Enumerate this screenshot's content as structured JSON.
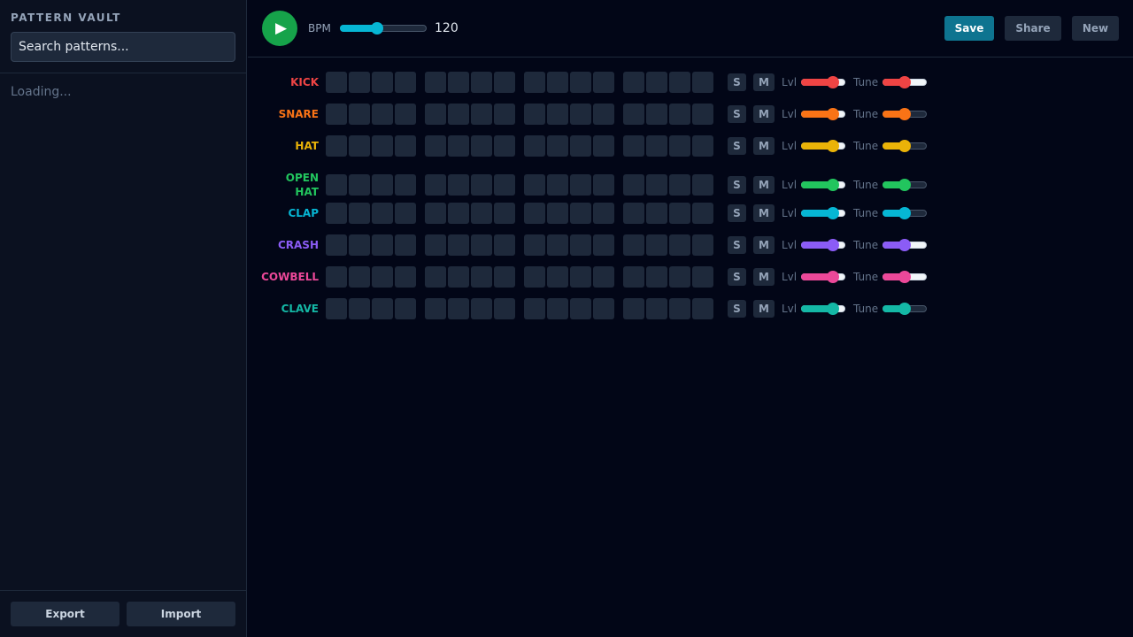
{
  "sidebar": {
    "title": "PATTERN VAULT",
    "search_placeholder": "Search patterns...",
    "status": "Loading...",
    "export_label": "Export",
    "import_label": "Import"
  },
  "transport": {
    "play_glyph": "▶",
    "bpm_label": "BPM",
    "bpm_value": "120",
    "bpm_fraction": 0.43,
    "save_label": "Save",
    "share_label": "Share",
    "new_label": "New"
  },
  "controls": {
    "solo_label": "S",
    "mute_label": "M",
    "level_label": "Lvl",
    "tune_label": "Tune"
  },
  "colors": {
    "play": "#16a34a",
    "accent": "#0e7490",
    "bpm": "#06b6d4"
  },
  "tracks": [
    {
      "name": "KICK",
      "lines": [
        "KICK"
      ],
      "color": "#ef4444",
      "level": 0.72,
      "tune": 0.5,
      "tune_light": true
    },
    {
      "name": "SNARE",
      "lines": [
        "SNARE"
      ],
      "color": "#f97316",
      "level": 0.72,
      "tune": 0.5,
      "tune_light": false
    },
    {
      "name": "HAT",
      "lines": [
        "HAT"
      ],
      "color": "#eab308",
      "level": 0.72,
      "tune": 0.5,
      "tune_light": false
    },
    {
      "name": "OPEN HAT",
      "lines": [
        "OPEN",
        "HAT"
      ],
      "color": "#22c55e",
      "level": 0.72,
      "tune": 0.5,
      "tune_light": false
    },
    {
      "name": "CLAP",
      "lines": [
        "CLAP"
      ],
      "color": "#06b6d4",
      "level": 0.72,
      "tune": 0.5,
      "tune_light": false
    },
    {
      "name": "CRASH",
      "lines": [
        "CRASH"
      ],
      "color": "#8b5cf6",
      "level": 0.72,
      "tune": 0.5,
      "tune_light": true
    },
    {
      "name": "COWBELL",
      "lines": [
        "COWBELL"
      ],
      "color": "#ec4899",
      "level": 0.72,
      "tune": 0.5,
      "tune_light": true
    },
    {
      "name": "CLAVE",
      "lines": [
        "CLAVE"
      ],
      "color": "#14b8a6",
      "level": 0.72,
      "tune": 0.5,
      "tune_light": false
    }
  ]
}
